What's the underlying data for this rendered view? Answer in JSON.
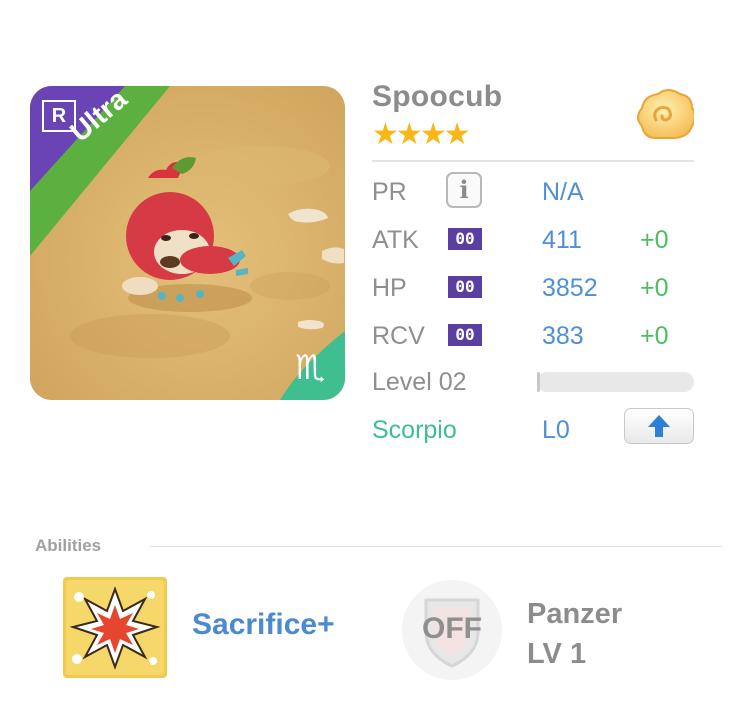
{
  "monster": {
    "name": "Spoocub",
    "stars": "★★★★",
    "rarity_badge": "R",
    "tier": "Ultra",
    "zodiac_symbol": "♏",
    "element_icon": "cloud-swirl-icon"
  },
  "stats": {
    "pr_label": "PR",
    "pr_value": "N/A",
    "atk_label": "ATK",
    "atk_badge": "00",
    "atk_value": "411",
    "atk_bonus": "+0",
    "hp_label": "HP",
    "hp_badge": "00",
    "hp_value": "3852",
    "hp_bonus": "+0",
    "rcv_label": "RCV",
    "rcv_badge": "00",
    "rcv_value": "383",
    "rcv_bonus": "+0",
    "level_label": "Level 02",
    "level_progress": 0.02,
    "zodiac_label": "Scorpio",
    "zodiac_level": "L0"
  },
  "abilities": {
    "title": "Abilities",
    "ability1_name": "Sacrifice+",
    "ability2_state": "OFF",
    "ability2_name": "Panzer",
    "ability2_level": "LV 1"
  },
  "colors": {
    "ultra_green": "#5cb040",
    "rarity_purple": "#6a44b4",
    "stat_blue": "#4f8fd4",
    "bonus_green": "#4dbd5c",
    "zodiac_teal": "#3fbf8f",
    "star_gold": "#f7b715"
  }
}
